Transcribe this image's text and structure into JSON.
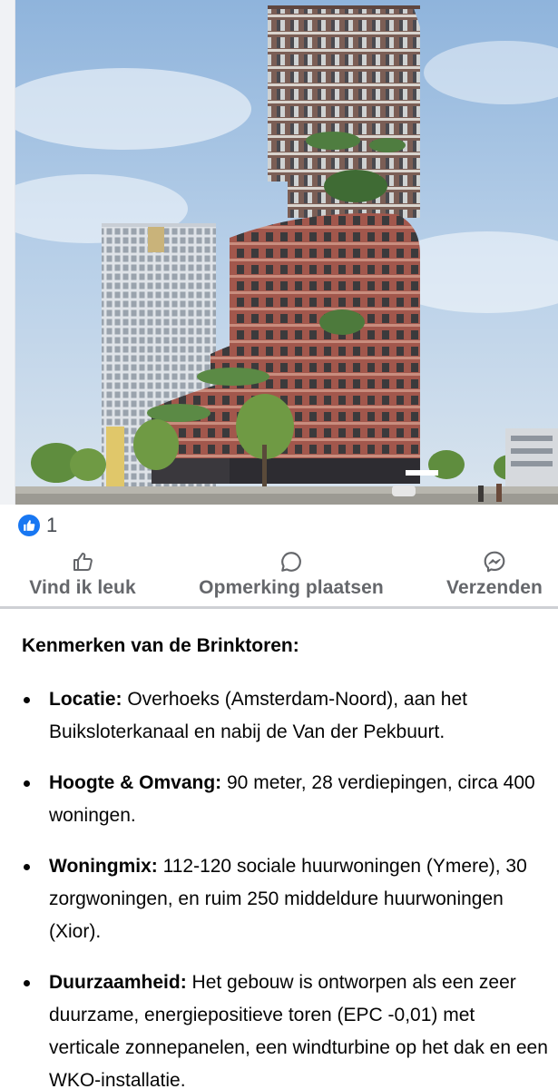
{
  "post": {
    "image_alt": "Rendering of the Brinktoren residential tower next to a grey office tower under a blue sky",
    "reaction_count": "1"
  },
  "actions": {
    "like_label": "Vind ik leuk",
    "comment_label": "Opmerking plaatsen",
    "send_label": "Verzenden"
  },
  "content": {
    "heading": "Kenmerken van de Brinktoren:",
    "items": [
      {
        "term": "Locatie:",
        "text": " Overhoeks (Amsterdam-Noord), aan het Buiksloterkanaal en nabij de Van der Pekbuurt."
      },
      {
        "term": "Hoogte & Omvang:",
        "text": " 90 meter, 28 verdiepingen, circa 400 woningen."
      },
      {
        "term": "Woningmix:",
        "text": " 112-120 sociale huurwoningen (Ymere), 30 zorgwoningen, en ruim 250 middeldure huurwoningen (Xior)."
      },
      {
        "term": "Duurzaamheid:",
        "text": " Het gebouw is ontworpen als een zeer duurzame, energiepositieve toren (EPC -0,01) met verticale zonnepanelen, een windturbine op het dak en een WKO-installatie."
      }
    ]
  },
  "colors": {
    "facebook_blue": "#1877f2",
    "secondary_text": "#65676b",
    "brick": "#9a5248",
    "sky": "#a9c6e4"
  },
  "icons": [
    "thumbs-up-icon",
    "comment-bubble-icon",
    "messenger-icon",
    "like-reaction-icon"
  ]
}
